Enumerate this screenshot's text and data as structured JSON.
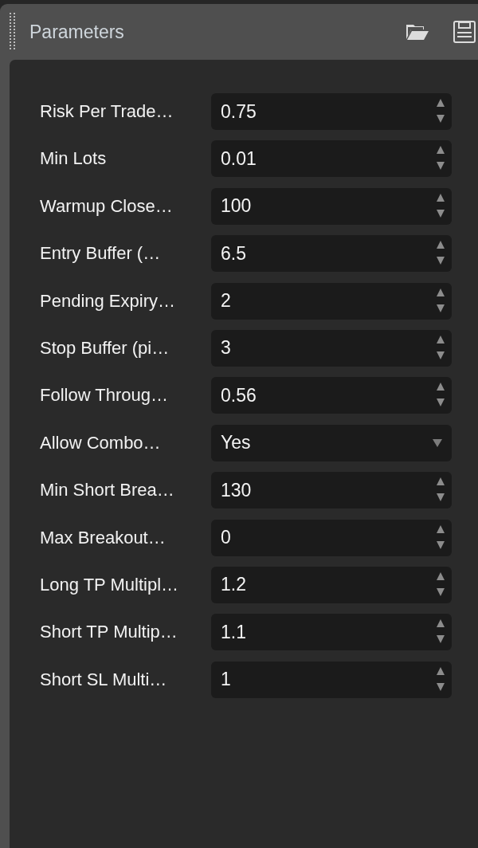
{
  "panel": {
    "title": "Parameters"
  },
  "parameters": [
    {
      "label": "Risk Per Trade…",
      "kind": "number",
      "value": "0.75"
    },
    {
      "label": "Min Lots",
      "kind": "number",
      "value": "0.01"
    },
    {
      "label": "Warmup Close…",
      "kind": "number",
      "value": "100"
    },
    {
      "label": "Entry Buffer (…",
      "kind": "number",
      "value": "6.5"
    },
    {
      "label": "Pending Expiry…",
      "kind": "number",
      "value": "2"
    },
    {
      "label": "Stop Buffer (pi…",
      "kind": "number",
      "value": "3"
    },
    {
      "label": "Follow Throug…",
      "kind": "number",
      "value": "0.56"
    },
    {
      "label": "Allow Combo…",
      "kind": "select",
      "value": "Yes"
    },
    {
      "label": "Min Short Brea…",
      "kind": "number",
      "value": "130"
    },
    {
      "label": "Max Breakout…",
      "kind": "number",
      "value": "0"
    },
    {
      "label": "Long TP Multipl…",
      "kind": "number",
      "value": "1.2"
    },
    {
      "label": "Short TP Multip…",
      "kind": "number",
      "value": "1.1"
    },
    {
      "label": "Short SL Multi…",
      "kind": "number",
      "value": "1"
    }
  ]
}
